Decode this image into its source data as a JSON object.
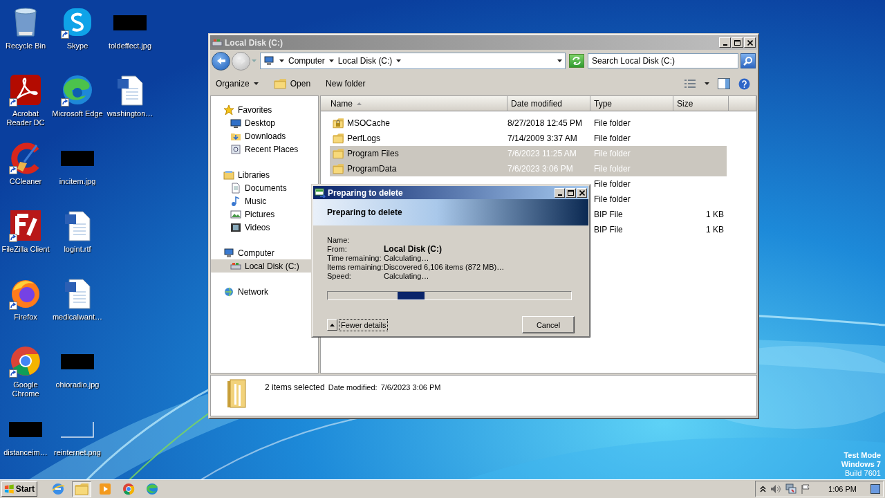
{
  "desktop": {
    "icons": [
      {
        "label": "Recycle Bin",
        "shortcut": false
      },
      {
        "label": "Acrobat Reader DC",
        "shortcut": true
      },
      {
        "label": "CCleaner",
        "shortcut": true
      },
      {
        "label": "FileZilla Client",
        "shortcut": true
      },
      {
        "label": "Firefox",
        "shortcut": true
      },
      {
        "label": "Google Chrome",
        "shortcut": true
      },
      {
        "label": "distanceim…",
        "shortcut": false
      },
      {
        "label": "Skype",
        "shortcut": true
      },
      {
        "label": "Microsoft Edge",
        "shortcut": true
      },
      {
        "label": "incitem.jpg",
        "shortcut": false
      },
      {
        "label": "logint.rtf",
        "shortcut": false
      },
      {
        "label": "medicalwant…",
        "shortcut": false
      },
      {
        "label": "ohioradio.jpg",
        "shortcut": false
      },
      {
        "label": "reinternet.png",
        "shortcut": false
      },
      {
        "label": "toldeffect.jpg",
        "shortcut": false
      },
      {
        "label": "washington…",
        "shortcut": false
      }
    ],
    "notice": [
      "Test Mode",
      "Windows 7",
      "Build 7601"
    ]
  },
  "explorer": {
    "title": "Local Disk (C:)",
    "breadcrumb": [
      "Computer",
      "Local Disk (C:)"
    ],
    "search": {
      "placeholder": "Search Local Disk (C:)"
    },
    "toolbar": [
      {
        "label": "Organize",
        "kind": "menu"
      },
      {
        "label": "Open",
        "kind": "icon"
      },
      {
        "label": "New folder",
        "kind": "plain"
      }
    ],
    "sidebar": {
      "items": [
        {
          "label": "Favorites",
          "selected": false,
          "children": [
            {
              "label": "Desktop",
              "selected": false
            },
            {
              "label": "Downloads",
              "selected": false
            },
            {
              "label": "Recent Places",
              "selected": false
            }
          ]
        },
        {
          "label": "Libraries",
          "selected": false,
          "children": [
            {
              "label": "Documents",
              "selected": false
            },
            {
              "label": "Music",
              "selected": false
            },
            {
              "label": "Pictures",
              "selected": false
            },
            {
              "label": "Videos",
              "selected": false
            }
          ]
        },
        {
          "label": "Computer",
          "selected": false,
          "children": [
            {
              "label": "Local Disk (C:)",
              "selected": true
            }
          ]
        },
        {
          "label": "Network",
          "selected": false
        }
      ]
    },
    "table": {
      "columns": [
        {
          "label": "Name",
          "sorted": true
        },
        {
          "label": "Date modified",
          "sorted": false
        },
        {
          "label": "Type",
          "sorted": false
        },
        {
          "label": "Size",
          "sorted": false
        }
      ],
      "rows": [
        {
          "name": "MSOCache",
          "date": "8/27/2018 12:45 PM",
          "type": "File folder",
          "kind": "locked",
          "selected": false
        },
        {
          "name": "PerfLogs",
          "date": "7/14/2009 3:37 AM",
          "type": "File folder",
          "kind": "folder",
          "selected": false
        },
        {
          "name": "Program Files",
          "date": "7/6/2023 11:25 AM",
          "type": "File folder",
          "kind": "folder",
          "selected": true
        },
        {
          "name": "ProgramData",
          "date": "7/6/2023 3:06 PM",
          "type": "File folder",
          "kind": "folder",
          "selected": true
        },
        {
          "type": "File folder",
          "selected": false
        },
        {
          "type": "File folder",
          "selected": false
        },
        {
          "type": "BIP File",
          "size": "1 KB",
          "selected": false
        },
        {
          "type": "BIP File",
          "size": "1 KB",
          "selected": false
        }
      ]
    },
    "details": {
      "summary": "2 items selected",
      "label": "Date modified:",
      "value": "7/6/2023 3:06 PM"
    }
  },
  "dialog": {
    "title": "Preparing to delete",
    "heading": "Preparing to delete",
    "details": [
      {
        "label": "Name:"
      },
      {
        "label": "From:",
        "value": "Local Disk (C:)",
        "bold": true
      },
      {
        "label": "Time remaining:",
        "value": "Calculating…",
        "bold": false
      },
      {
        "label": "Items remaining:",
        "value": "Discovered 6,106 items (872 MB)…",
        "bold": false
      },
      {
        "label": "Speed:",
        "value": "Calculating…",
        "bold": false
      }
    ],
    "progress": {
      "indeterminate": true
    },
    "toggle": {
      "label": "Fewer details",
      "expanded": true
    },
    "buttons": [
      "Cancel"
    ]
  },
  "taskbar": {
    "start": "Start",
    "pinned": [
      {
        "selected": false
      },
      {
        "selected": true
      },
      {
        "selected": false
      },
      {
        "selected": false
      },
      {
        "selected": false
      }
    ],
    "clock": "1:06 PM"
  }
}
